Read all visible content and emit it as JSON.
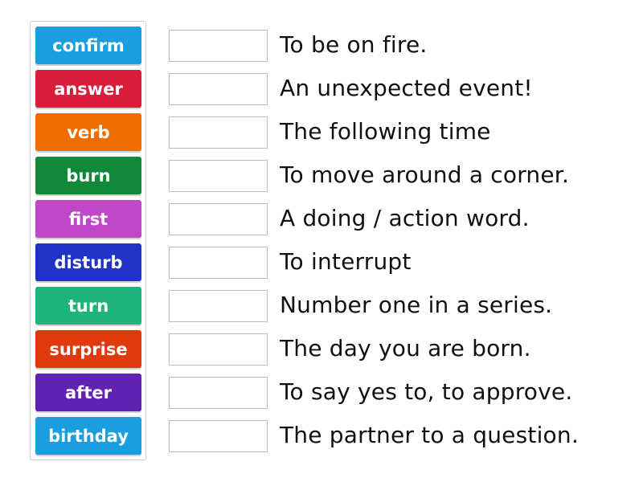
{
  "words": [
    {
      "label": "confirm",
      "color": "#1a9ee0"
    },
    {
      "label": "answer",
      "color": "#d81e3a"
    },
    {
      "label": "verb",
      "color": "#ef6c00"
    },
    {
      "label": "burn",
      "color": "#12883a"
    },
    {
      "label": "first",
      "color": "#c048c8"
    },
    {
      "label": "disturb",
      "color": "#2133c4"
    },
    {
      "label": "turn",
      "color": "#1db37b"
    },
    {
      "label": "surprise",
      "color": "#e0390e"
    },
    {
      "label": "after",
      "color": "#6122b3"
    },
    {
      "label": "birthday",
      "color": "#1a9ee0"
    }
  ],
  "clues": [
    "To be on fire.",
    "An unexpected event!",
    "The following time",
    "To move around a corner.",
    "A doing / action word.",
    "To interrupt",
    "Number one in a series.",
    "The day you are born.",
    "To say yes to, to approve.",
    "The partner to a question."
  ]
}
